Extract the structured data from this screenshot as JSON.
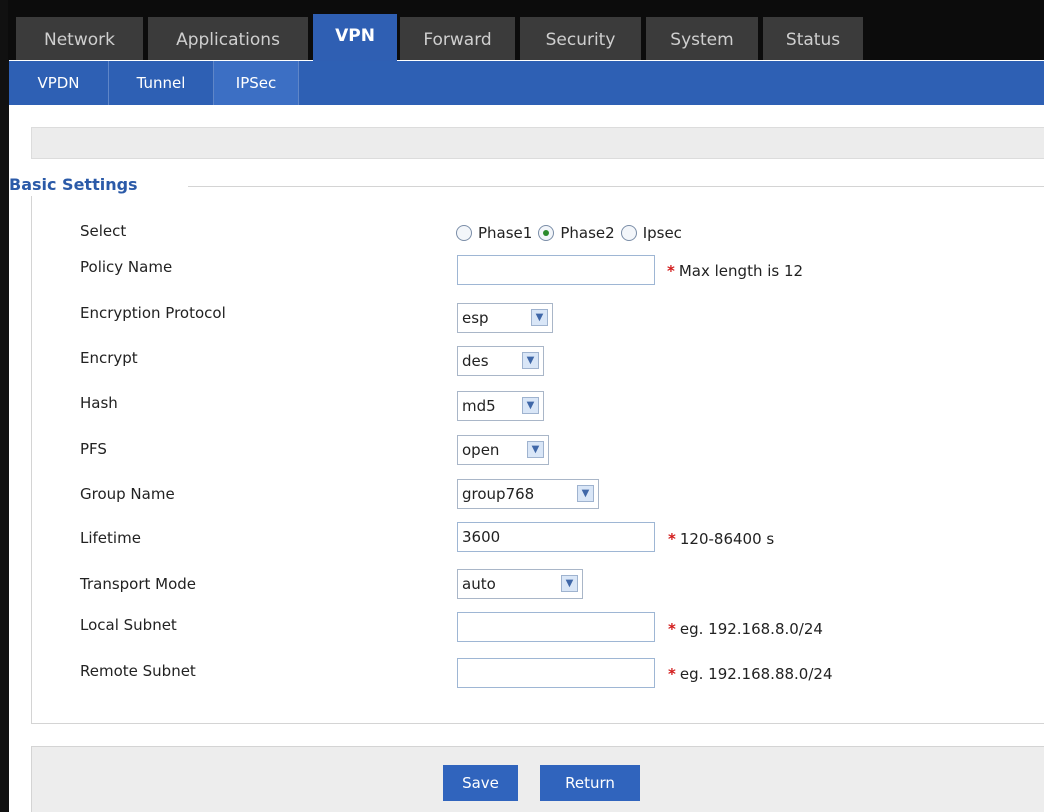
{
  "nav": {
    "tabs": [
      "Network",
      "Applications",
      "VPN",
      "Forward",
      "Security",
      "System",
      "Status"
    ],
    "active_tab": "VPN"
  },
  "subnav": {
    "tabs": [
      "VPDN",
      "Tunnel",
      "IPSec"
    ],
    "active_tab": "IPSec"
  },
  "section": {
    "title": "Basic Settings"
  },
  "form": {
    "select_label": "Select",
    "radio_options": [
      "Phase1",
      "Phase2",
      "Ipsec"
    ],
    "radio_selected": "Phase2",
    "policy_name": {
      "label": "Policy Name",
      "value": "",
      "hint": "Max length is 12"
    },
    "encryption_protocol": {
      "label": "Encryption Protocol",
      "value": "esp"
    },
    "encrypt": {
      "label": "Encrypt",
      "value": "des"
    },
    "hash": {
      "label": "Hash",
      "value": "md5"
    },
    "pfs": {
      "label": "PFS",
      "value": "open"
    },
    "group_name": {
      "label": "Group Name",
      "value": "group768"
    },
    "lifetime": {
      "label": "Lifetime",
      "value": "3600",
      "hint": "120-86400 s"
    },
    "transport_mode": {
      "label": "Transport Mode",
      "value": "auto"
    },
    "local_subnet": {
      "label": "Local Subnet",
      "value": "",
      "hint": "eg. 192.168.8.0/24"
    },
    "remote_subnet": {
      "label": "Remote Subnet",
      "value": "",
      "hint": "eg. 192.168.88.0/24"
    },
    "required_marker": "*"
  },
  "buttons": {
    "save": "Save",
    "return": "Return"
  },
  "colors": {
    "nav_bg": "#0c0c0c",
    "tab_bg": "#3b3b3b",
    "accent": "#2f5fb3",
    "section_title": "#2b5aa8",
    "required": "#d21b1b"
  }
}
